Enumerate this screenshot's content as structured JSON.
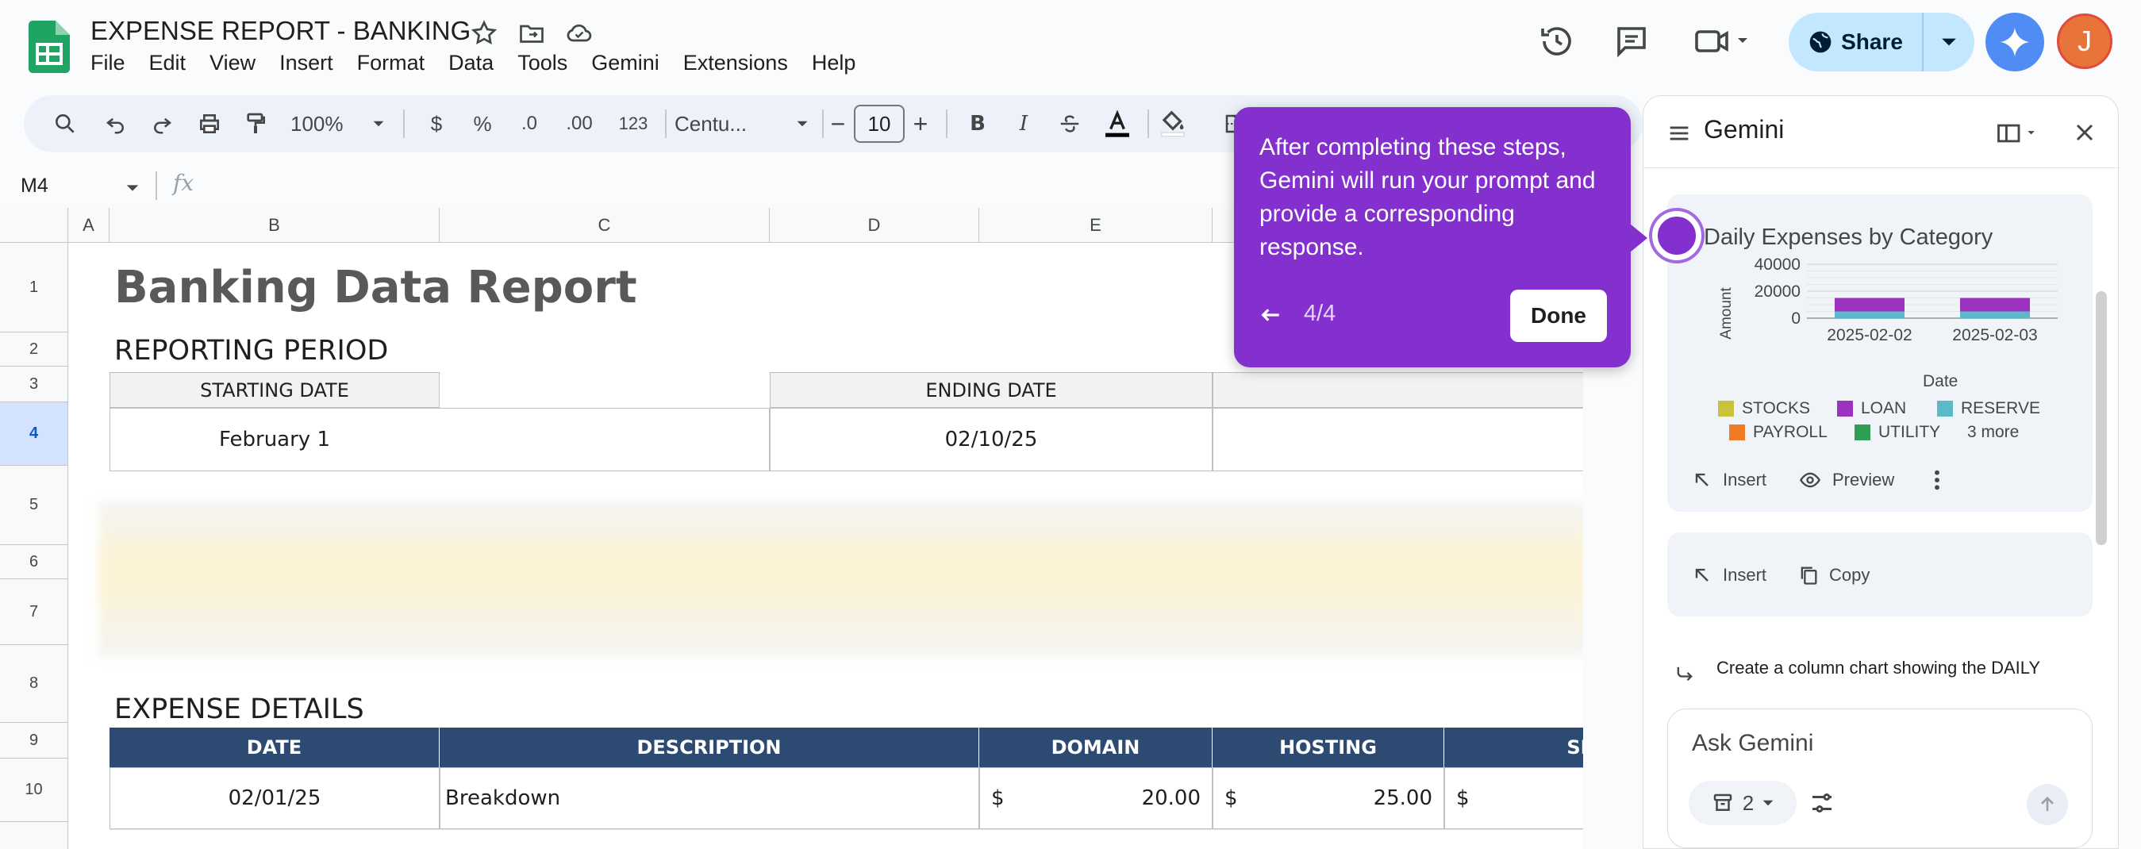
{
  "app": {
    "doc_title": "EXPENSE REPORT - BANKING",
    "menu": [
      "File",
      "Edit",
      "View",
      "Insert",
      "Format",
      "Data",
      "Tools",
      "Gemini",
      "Extensions",
      "Help"
    ],
    "share_label": "Share",
    "avatar_initial": "J",
    "colors": {
      "accent": "#0b57d0",
      "share_bg": "#c2e7ff",
      "tooltip_bg": "#8430ce",
      "header_row": "#2c4a72"
    }
  },
  "toolbar": {
    "zoom": "100%",
    "currency": "$",
    "percent": "%",
    "dec_decrease": ".0",
    "dec_increase": ".00",
    "format_123": "123",
    "font": "Centu...",
    "font_size": "10",
    "minus": "−",
    "plus": "+",
    "bold": "B",
    "italic": "I"
  },
  "formula_bar": {
    "cell_ref": "M4",
    "fx": "fx"
  },
  "sheet": {
    "columns": [
      "A",
      "B",
      "C",
      "D",
      "E"
    ],
    "rows": [
      "1",
      "2",
      "3",
      "4",
      "5",
      "6",
      "7",
      "8",
      "9",
      "10"
    ],
    "report_title": "Banking Data Report",
    "reporting_period": "REPORTING PERIOD",
    "starting_date_label": "STARTING DATE",
    "ending_date_label": "ENDING DATE",
    "starting_date": "February 1",
    "ending_date": "02/10/25",
    "expense_details": "EXPENSE DETAILS",
    "table_headers": [
      "DATE",
      "DESCRIPTION",
      "DOMAIN",
      "HOSTING",
      "SEC"
    ],
    "row10": {
      "date": "02/01/25",
      "description": "Breakdown",
      "dollar": "$",
      "domain": "20.00",
      "hosting": "25.00"
    }
  },
  "tooltip": {
    "text": "After completing these steps, Gemini will run your prompt and provide a corresponding response.",
    "step": "4/4",
    "done_label": "Done"
  },
  "gemini": {
    "title": "Gemini",
    "chart_title": "Daily Expenses by Category",
    "insert_label": "Insert",
    "preview_label": "Preview",
    "copy_label": "Copy",
    "prompt_text": "Create a column chart showing the DAILY",
    "ask_placeholder": "Ask Gemini",
    "sources_count": "2",
    "legend": [
      {
        "name": "STOCKS",
        "color": "#c9c23b"
      },
      {
        "name": "LOAN",
        "color": "#9c33bf"
      },
      {
        "name": "RESERVE",
        "color": "#5bbac9"
      },
      {
        "name": "PAYROLL",
        "color": "#f07a25"
      },
      {
        "name": "UTILITY",
        "color": "#2f9e55"
      }
    ],
    "more_label": "3 more"
  },
  "chart_data": {
    "type": "bar",
    "title": "Daily Expenses by Category",
    "xlabel": "Date",
    "ylabel": "Amount",
    "categories": [
      "2025-02-02",
      "2025-02-03"
    ],
    "ylim": [
      0,
      40000
    ],
    "yticks": [
      "40000",
      "20000",
      "0"
    ],
    "stacked": true,
    "series": [
      {
        "name": "RESERVE",
        "values": [
          5000,
          5000
        ]
      },
      {
        "name": "LOAN",
        "values": [
          10000,
          10000
        ]
      }
    ]
  }
}
